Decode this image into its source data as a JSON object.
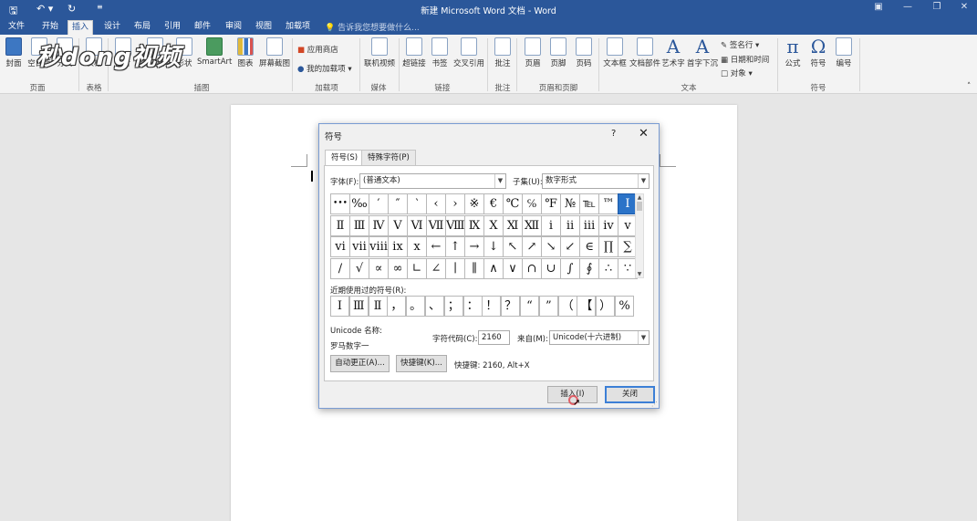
{
  "titlebar": {
    "title": "新建 Microsoft Word 文档 - Word",
    "save_icon": "save-icon",
    "undo_icon": "undo-icon",
    "redo_icon": "redo-icon"
  },
  "tabs": [
    "文件",
    "开始",
    "插入",
    "设计",
    "布局",
    "引用",
    "邮件",
    "审阅",
    "视图",
    "加载项"
  ],
  "active_tab": "插入",
  "tell_me": "告诉我您想要做什么...",
  "ribbon": {
    "pages": [
      "封面",
      "空白页",
      "分页"
    ],
    "table": "表格",
    "illustrations": [
      "图片",
      "联机图片",
      "形状",
      "SmartArt",
      "图表",
      "屏幕截图"
    ],
    "addins": [
      "应用商店",
      "我的加载项"
    ],
    "media": "联机视频",
    "links": [
      "超链接",
      "书签",
      "交叉引用"
    ],
    "comment": "批注",
    "header_footer": [
      "页眉",
      "页脚",
      "页码"
    ],
    "text": [
      "文本框",
      "文档部件",
      "艺术字",
      "首字下沉"
    ],
    "text_small": [
      "签名行",
      "日期和时间",
      "对象"
    ],
    "symbols": [
      "公式",
      "符号",
      "编号"
    ],
    "groups": [
      "页面",
      "表格",
      "插图",
      "加载项",
      "媒体",
      "链接",
      "批注",
      "页眉和页脚",
      "文本",
      "符号"
    ]
  },
  "watermark": "秒dong视频",
  "dialog": {
    "title": "符号",
    "help": "?",
    "tabs": [
      "符号(S)",
      "特殊字符(P)"
    ],
    "font_label": "字体(F):",
    "font_value": "(普通文本)",
    "subset_label": "子集(U):",
    "subset_value": "数字形式",
    "symbols": [
      "•••",
      "‰",
      "′",
      "″",
      "‵",
      "‹",
      "›",
      "※",
      "€",
      "℃",
      "℅",
      "℉",
      "№",
      "℡",
      "™",
      "Ⅰ",
      "Ⅱ",
      "Ⅲ",
      "Ⅳ",
      "Ⅴ",
      "Ⅵ",
      "Ⅶ",
      "Ⅷ",
      "Ⅸ",
      "Ⅹ",
      "Ⅺ",
      "Ⅻ",
      "ⅰ",
      "ⅱ",
      "ⅲ",
      "ⅳ",
      "ⅴ",
      "ⅵ",
      "ⅶ",
      "ⅷ",
      "ⅸ",
      "ⅹ",
      "←",
      "↑",
      "→",
      "↓",
      "↖",
      "↗",
      "↘",
      "↙",
      "∈",
      "∏",
      "∑",
      "∕",
      "√",
      "∝",
      "∞",
      "∟",
      "∠",
      "∣",
      "∥",
      "∧",
      "∨",
      "∩",
      "∪",
      "∫",
      "∮",
      "∴",
      "∵"
    ],
    "selected_symbol": "Ⅰ",
    "recent_label": "近期使用过的符号(R):",
    "recent": [
      "Ⅰ",
      "Ⅲ",
      "Ⅱ",
      "，",
      "。",
      "、",
      "；",
      "：",
      "！",
      "？",
      "“",
      "”",
      "（",
      "【",
      "）",
      "%"
    ],
    "unicode_name_label": "Unicode 名称:",
    "unicode_name_value": "罗马数字一",
    "char_code_label": "字符代码(C):",
    "char_code_value": "2160",
    "from_label": "来自(M):",
    "from_value": "Unicode(十六进制)",
    "autocorrect_button": "自动更正(A)...",
    "shortcut_button": "快捷键(K)...",
    "shortcut_text": "快捷键: 2160, Alt+X",
    "insert_button": "插入(I)",
    "close_button": "关闭"
  }
}
